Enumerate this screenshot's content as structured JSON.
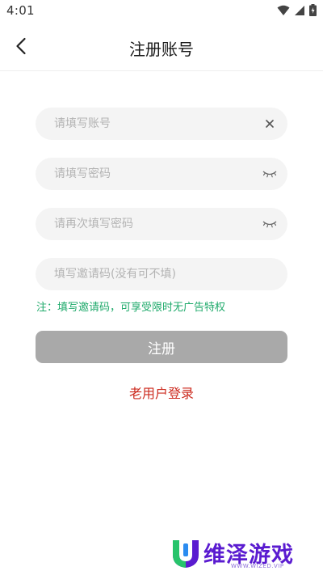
{
  "status_bar": {
    "time": "4:01"
  },
  "header": {
    "title": "注册账号"
  },
  "form": {
    "account_placeholder": "请填写账号",
    "password_placeholder": "请填写密码",
    "confirm_placeholder": "请再次填写密码",
    "invite_placeholder": "填写邀请码(没有可不填)",
    "hint": "注：填写邀请码，可享受限时无广告特权",
    "register_label": "注册",
    "login_link": "老用户登录"
  },
  "watermark": {
    "text": "维泽游戏",
    "sub": "WWW.WIZED.VIP"
  },
  "colors": {
    "hint": "#1faa6b",
    "login_link": "#cc2a1e",
    "register_disabled": "#a9a9a9",
    "watermark": "#5a1bd0"
  },
  "icons": {
    "clear": "close-icon",
    "password_toggle": "eye-closed-icon",
    "back": "chevron-left-icon"
  }
}
